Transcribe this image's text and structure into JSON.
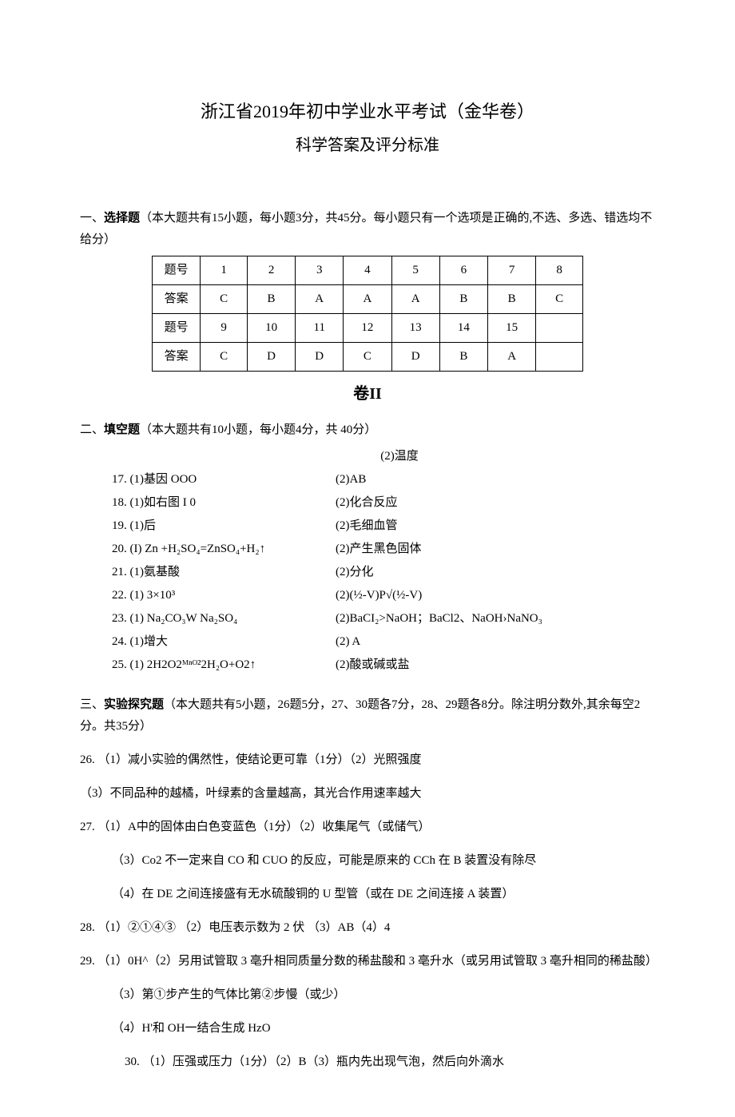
{
  "header": {
    "title1": "浙江省2019年初中学业水平考试（金华卷）",
    "title2": "科学答案及评分标准"
  },
  "section1": {
    "head_prefix": "一、",
    "head_bold": "选择题",
    "head_rest": "（本大题共有15小题，每小题3分，共45分。每小题只有一个选项是正确的,不选、多选、错选均不给分）",
    "table": {
      "row1_label": "题号",
      "row1": [
        "1",
        "2",
        "3",
        "4",
        "5",
        "6",
        "7",
        "8"
      ],
      "row2_label": "答案",
      "row2": [
        "C",
        "B",
        "A",
        "A",
        "A",
        "B",
        "B",
        "C"
      ],
      "row3_label": "题号",
      "row3": [
        "9",
        "10",
        "11",
        "12",
        "13",
        "14",
        "15",
        ""
      ],
      "row4_label": "答案",
      "row4": [
        "C",
        "D",
        "D",
        "C",
        "D",
        "B",
        "A",
        ""
      ]
    }
  },
  "juan2": "卷II",
  "section2": {
    "head_prefix": "二、",
    "head_bold": "填空题",
    "head_rest": "（本大题共有10小题，每小题4分，共 40分）",
    "right_top": "(2)温度",
    "left": [
      "17. (1)基因               OOO",
      "18. (1)如右图 I 0",
      "19. (1)后",
      "20. (I) Zn +H₂SO₄=ZnSO₄+H₂↑",
      "21. (1)氨基酸",
      "22. (1) 3×10³",
      "23. (1) Na₂CO₃W Na₂SO₄",
      "24. (1)增大",
      "25. (1) 2H2O2ᴹⁿᴼ²2H₂O+O2↑"
    ],
    "right": [
      "(2)AB",
      "(2)化合反应",
      "(2)毛细血管",
      "(2)产生黑色固体",
      "(2)分化",
      "(2)(½-V)P√(½-V)",
      "(2)BaCI₂>NaOH；BaCl2、NaOH›NaNO₃",
      "(2)       A",
      "(2)酸或碱或盐"
    ]
  },
  "section3": {
    "head_prefix": "三、",
    "head_bold": "实验探究题",
    "head_rest": "（本大题共有5小题，26题5分，27、30题各7分，28、29题各8分。除注明分数外,其余每空2分。共35分）",
    "q26_a": "26. （1）减小实验的偶然性，使结论更可靠（1分）（2）光照强度",
    "q26_b": "（3）不同品种的越橘，叶绿素的含量越高，其光合作用速率越大",
    "q27_a": "27. （1）A中的固体由白色变蓝色（1分）（2）收集尾气（或储气）",
    "q27_b": "（3）Co2 不一定来自 CO 和 CUO 的反应，可能是原来的 CCh 在 B 装置没有除尽",
    "q27_c": "（4）在 DE 之间连接盛有无水硫酸铜的 U 型管（或在 DE 之间连接 A 装置）",
    "q28": "28. （1）②①④③    （2）电压表示数为 2 伏        （3）AB（4）4",
    "q29_a": "29. （1）0H^（2）另用试管取 3 亳升相同质量分数的稀盐酸和 3 亳升水（或另用试管取 3 亳升相同的稀盐酸）",
    "q29_b": "（3）第①步产生的气体比第②步慢（或少）",
    "q29_c": "（4）H'和 OH一结合生成 HzO",
    "q30": "30.  （1）压强或压力（1分）（2）B（3）瓶内先出现气泡，然后向外滴水"
  }
}
